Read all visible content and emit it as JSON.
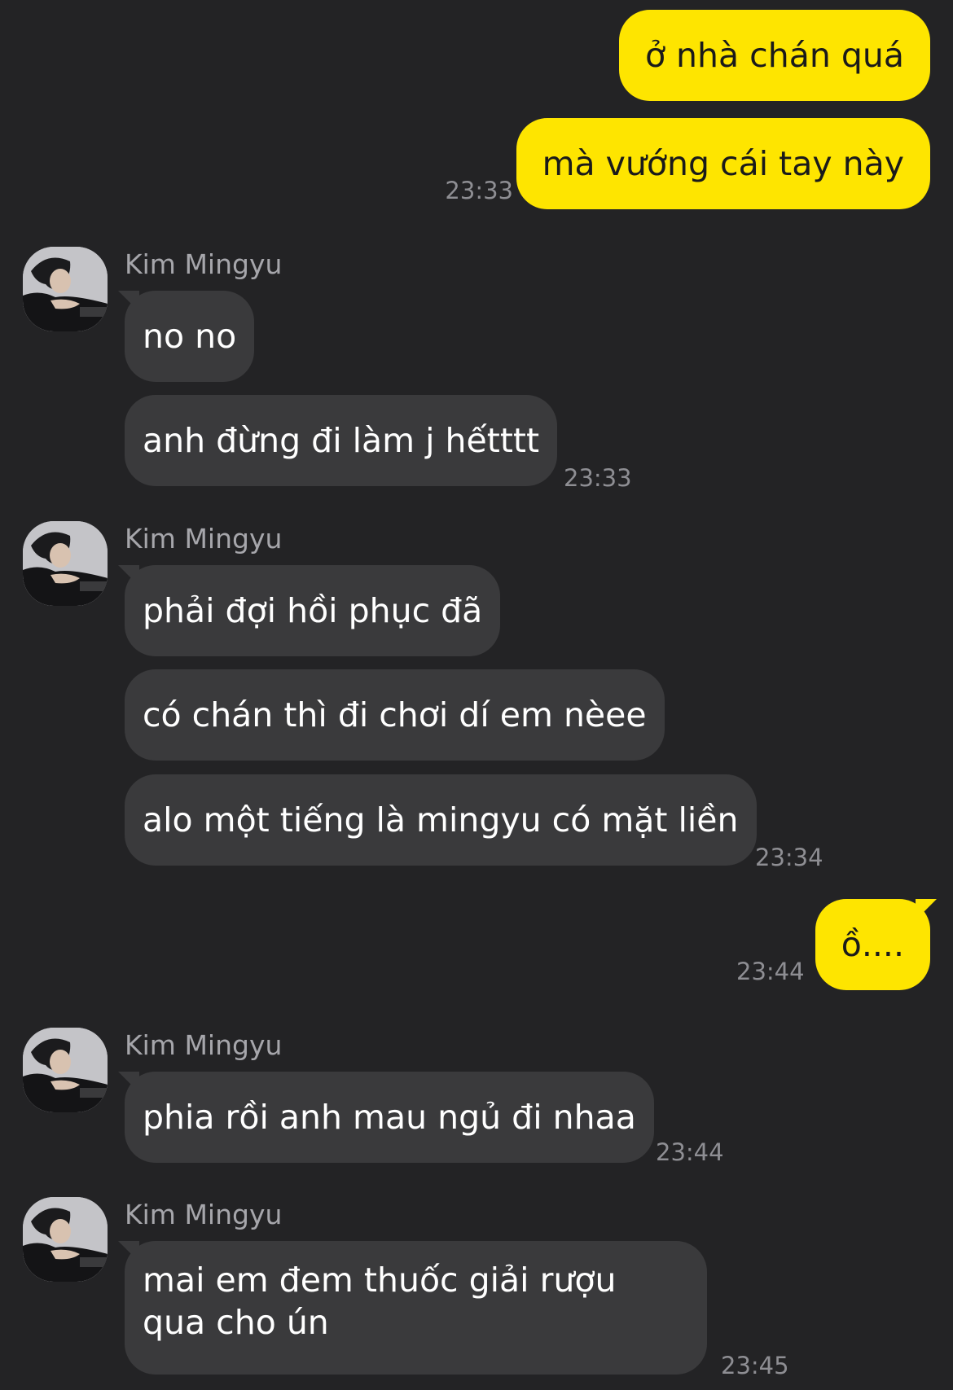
{
  "theme": {
    "background": "#232325",
    "outgoing_bubble": "#FEE500",
    "incoming_bubble": "#3a3a3c",
    "timestamp_color": "#8e8e93"
  },
  "messages": [
    {
      "direction": "out",
      "text": "ở nhà chán quá"
    },
    {
      "direction": "out",
      "text": "mà vướng cái tay này",
      "time": "23:33"
    },
    {
      "direction": "in",
      "sender": "Kim Mingyu",
      "avatar_icon": "profile-photo"
    },
    {
      "direction": "in",
      "text": "no no"
    },
    {
      "direction": "in",
      "text": "anh đừng đi làm j hếtttt",
      "time": "23:33"
    },
    {
      "direction": "in",
      "sender": "Kim Mingyu",
      "avatar_icon": "profile-photo"
    },
    {
      "direction": "in",
      "text": "phải đợi hồi phục đã"
    },
    {
      "direction": "in",
      "text": "có chán thì đi chơi dí em nèee"
    },
    {
      "direction": "in",
      "text": "alo một tiếng là mingyu có mặt liền",
      "time": "23:34"
    },
    {
      "direction": "out",
      "text": "ồ....",
      "time": "23:44"
    },
    {
      "direction": "in",
      "sender": "Kim Mingyu",
      "avatar_icon": "profile-photo"
    },
    {
      "direction": "in",
      "text": "phia rồi anh mau ngủ đi nhaa",
      "time": "23:44"
    },
    {
      "direction": "in",
      "sender": "Kim Mingyu",
      "avatar_icon": "profile-photo"
    },
    {
      "direction": "in",
      "text": "mai em đem thuốc giải rượu qua cho ún",
      "time": "23:45"
    }
  ]
}
